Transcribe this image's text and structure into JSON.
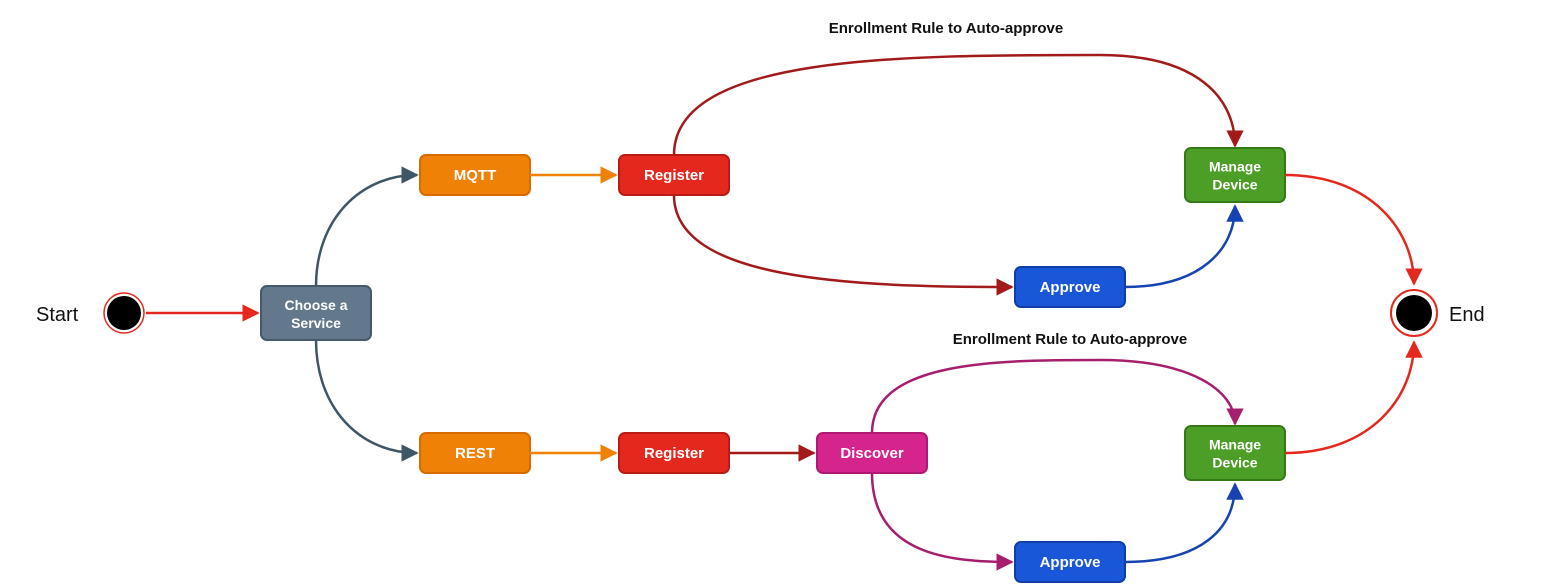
{
  "labels": {
    "start": "Start",
    "end": "End",
    "choose": "Choose a Service",
    "mqtt": "MQTT",
    "rest": "REST",
    "register1": "Register",
    "register2": "Register",
    "discover": "Discover",
    "approve1": "Approve",
    "approve2": "Approve",
    "manage1a": "Manage",
    "manage1b": "Device",
    "manage2a": "Manage",
    "manage2b": "Device",
    "enroll1": "Enrollment Rule to Auto-approve",
    "enroll2": "Enrollment Rule to Auto-approve"
  },
  "colors": {
    "slate": "#63788a",
    "slate_stroke": "#455a6b",
    "orange": "#ef8107",
    "orange_stroke": "#d66b00",
    "red": "#e5281e",
    "red_stroke": "#b81c14",
    "magenta": "#d6248d",
    "magenta_stroke": "#b01872",
    "blue": "#1957d8",
    "blue_stroke": "#0f3fa6",
    "green": "#4d9e27",
    "green_stroke": "#357a18",
    "arrow_red": "#e5281e",
    "arrow_slate": "#3f5666",
    "arrow_orange": "#ef8107",
    "arrow_darkred": "#a31a1a",
    "arrow_magenta": "#a61f6d",
    "arrow_blue": "#1642b2"
  }
}
